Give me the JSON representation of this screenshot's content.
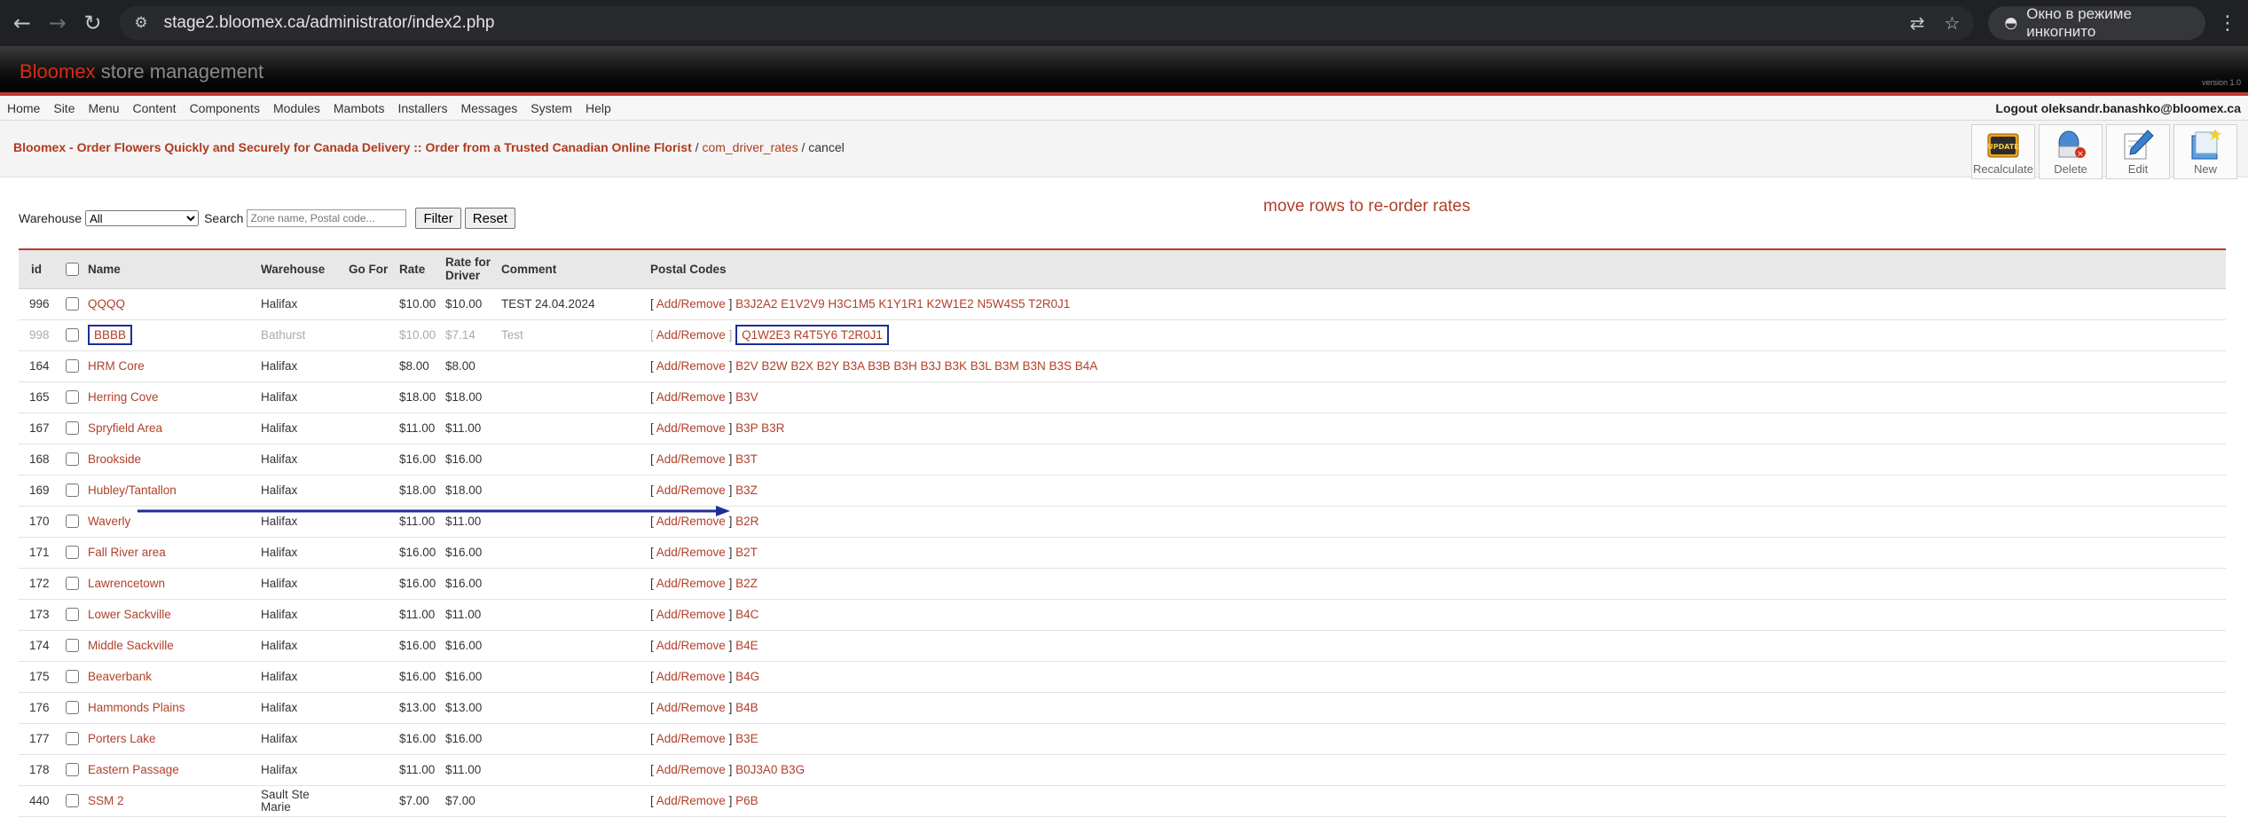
{
  "browser": {
    "url": "stage2.bloomex.ca/administrator/index2.php",
    "incognito_label": "Окно в режиме инкогнито"
  },
  "header": {
    "brand_red": "Bloomex",
    "brand_grey": "store management",
    "version": "version 1.0"
  },
  "menu": {
    "items": [
      "Home",
      "Site",
      "Menu",
      "Content",
      "Components",
      "Modules",
      "Mambots",
      "Installers",
      "Messages",
      "System",
      "Help"
    ],
    "logout": "Logout oleksandr.banashko@bloomex.ca"
  },
  "breadcrumb": {
    "site": "Bloomex - Order Flowers Quickly and Securely for Canada Delivery :: Order from a Trusted Canadian Online Florist",
    "sep1": " / ",
    "component": "com_driver_rates",
    "sep2": " / ",
    "task": "cancel"
  },
  "toolbar": {
    "recalculate": "Recalculate",
    "update_badge": "UPDATE",
    "delete": "Delete",
    "edit": "Edit",
    "new": "New"
  },
  "filters": {
    "warehouse_label": "Warehouse",
    "warehouse_value": "All",
    "search_label": "Search",
    "search_placeholder": "Zone name, Postal code...",
    "filter_button": "Filter",
    "reset_button": "Reset"
  },
  "notice": "move rows to re-order rates",
  "table": {
    "headers": {
      "id": "id",
      "name": "Name",
      "warehouse": "Warehouse",
      "go_for": "Go For",
      "rate": "Rate",
      "rate_driver_1": "Rate for",
      "rate_driver_2": "Driver",
      "comment": "Comment",
      "postal": "Postal Codes"
    },
    "add_remove": "Add/Remove",
    "rows": [
      {
        "id": "996",
        "name": "QQQQ",
        "warehouse": "Halifax",
        "rate": "$10.00",
        "driver": "$10.00",
        "comment": "TEST 24.04.2024",
        "codes": "B3J2A2 E1V2V9 H3C1M5 K1Y1R1 K2W1E2 N5W4S5 T2R0J1"
      },
      {
        "id": "998",
        "name": "BBBB",
        "warehouse": "Bathurst",
        "rate": "$10.00",
        "driver": "$7.14",
        "comment": "Test",
        "codes": "Q1W2E3 R4T5Y6 T2R0J1"
      },
      {
        "id": "164",
        "name": "HRM Core",
        "warehouse": "Halifax",
        "rate": "$8.00",
        "driver": "$8.00",
        "comment": "",
        "codes": "B2V B2W B2X B2Y B3A B3B B3H B3J B3K B3L B3M B3N B3S B4A"
      },
      {
        "id": "165",
        "name": "Herring Cove",
        "warehouse": "Halifax",
        "rate": "$18.00",
        "driver": "$18.00",
        "comment": "",
        "codes": "B3V"
      },
      {
        "id": "167",
        "name": "Spryfield Area",
        "warehouse": "Halifax",
        "rate": "$11.00",
        "driver": "$11.00",
        "comment": "",
        "codes": "B3P B3R"
      },
      {
        "id": "168",
        "name": "Brookside",
        "warehouse": "Halifax",
        "rate": "$16.00",
        "driver": "$16.00",
        "comment": "",
        "codes": "B3T"
      },
      {
        "id": "169",
        "name": "Hubley/Tantallon",
        "warehouse": "Halifax",
        "rate": "$18.00",
        "driver": "$18.00",
        "comment": "",
        "codes": "B3Z"
      },
      {
        "id": "170",
        "name": "Waverly",
        "warehouse": "Halifax",
        "rate": "$11.00",
        "driver": "$11.00",
        "comment": "",
        "codes": "B2R"
      },
      {
        "id": "171",
        "name": "Fall River area",
        "warehouse": "Halifax",
        "rate": "$16.00",
        "driver": "$16.00",
        "comment": "",
        "codes": "B2T"
      },
      {
        "id": "172",
        "name": "Lawrencetown",
        "warehouse": "Halifax",
        "rate": "$16.00",
        "driver": "$16.00",
        "comment": "",
        "codes": "B2Z"
      },
      {
        "id": "173",
        "name": "Lower Sackville",
        "warehouse": "Halifax",
        "rate": "$11.00",
        "driver": "$11.00",
        "comment": "",
        "codes": "B4C"
      },
      {
        "id": "174",
        "name": "Middle Sackville",
        "warehouse": "Halifax",
        "rate": "$16.00",
        "driver": "$16.00",
        "comment": "",
        "codes": "B4E"
      },
      {
        "id": "175",
        "name": "Beaverbank",
        "warehouse": "Halifax",
        "rate": "$16.00",
        "driver": "$16.00",
        "comment": "",
        "codes": "B4G"
      },
      {
        "id": "176",
        "name": "Hammonds Plains",
        "warehouse": "Halifax",
        "rate": "$13.00",
        "driver": "$13.00",
        "comment": "",
        "codes": "B4B"
      },
      {
        "id": "177",
        "name": "Porters Lake",
        "warehouse": "Halifax",
        "rate": "$16.00",
        "driver": "$16.00",
        "comment": "",
        "codes": "B3E"
      },
      {
        "id": "178",
        "name": "Eastern Passage",
        "warehouse": "Halifax",
        "rate": "$11.00",
        "driver": "$11.00",
        "comment": "",
        "codes": "B0J3A0 B3G"
      },
      {
        "id": "440",
        "name": "SSM 2",
        "warehouse": "Sault Ste Marie",
        "rate": "$7.00",
        "driver": "$7.00",
        "comment": "",
        "codes": "P6B"
      }
    ]
  },
  "colors": {
    "accent_red": "#c0392b",
    "link": "#b0402a",
    "annotation_blue": "#1c2e9a"
  }
}
